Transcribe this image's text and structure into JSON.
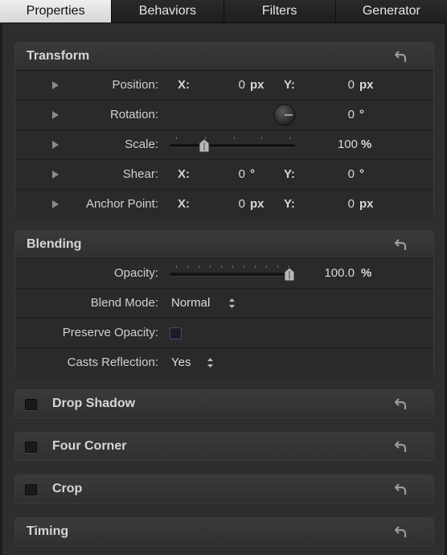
{
  "tabs": [
    {
      "label": "Properties",
      "active": true
    },
    {
      "label": "Behaviors",
      "active": false
    },
    {
      "label": "Filters",
      "active": false
    },
    {
      "label": "Generator",
      "active": false
    }
  ],
  "transform": {
    "title": "Transform",
    "position": {
      "label": "Position:",
      "x_axis": "X:",
      "x": "0",
      "x_unit": "px",
      "y_axis": "Y:",
      "y": "0",
      "y_unit": "px"
    },
    "rotation": {
      "label": "Rotation:",
      "value": "0",
      "unit": "°"
    },
    "scale": {
      "label": "Scale:",
      "value": "100",
      "unit": "%",
      "level_fraction": 0.25
    },
    "shear": {
      "label": "Shear:",
      "x_axis": "X:",
      "x": "0",
      "x_unit": "°",
      "y_axis": "Y:",
      "y": "0",
      "y_unit": "°"
    },
    "anchor": {
      "label": "Anchor Point:",
      "x_axis": "X:",
      "x": "0",
      "x_unit": "px",
      "y_axis": "Y:",
      "y": "0",
      "y_unit": "px"
    }
  },
  "blending": {
    "title": "Blending",
    "opacity": {
      "label": "Opacity:",
      "value": "100.0",
      "unit": "%",
      "level_fraction": 1.0
    },
    "blend_mode": {
      "label": "Blend Mode:",
      "value": "Normal"
    },
    "preserve_opacity": {
      "label": "Preserve Opacity:",
      "checked": false
    },
    "casts_reflection": {
      "label": "Casts Reflection:",
      "value": "Yes"
    }
  },
  "drop_shadow": {
    "title": "Drop Shadow",
    "enabled": false
  },
  "four_corner": {
    "title": "Four Corner",
    "enabled": false
  },
  "crop": {
    "title": "Crop",
    "enabled": false
  },
  "timing": {
    "title": "Timing"
  },
  "icons": {
    "reset": "reset-arrow-icon",
    "disclosure": "disclosure-triangle-icon",
    "stepper": "up-down-stepper-icon"
  },
  "colors": {
    "background": "#2e2e2e",
    "active_tab": "#e0e0e0",
    "panel": "#262626"
  }
}
